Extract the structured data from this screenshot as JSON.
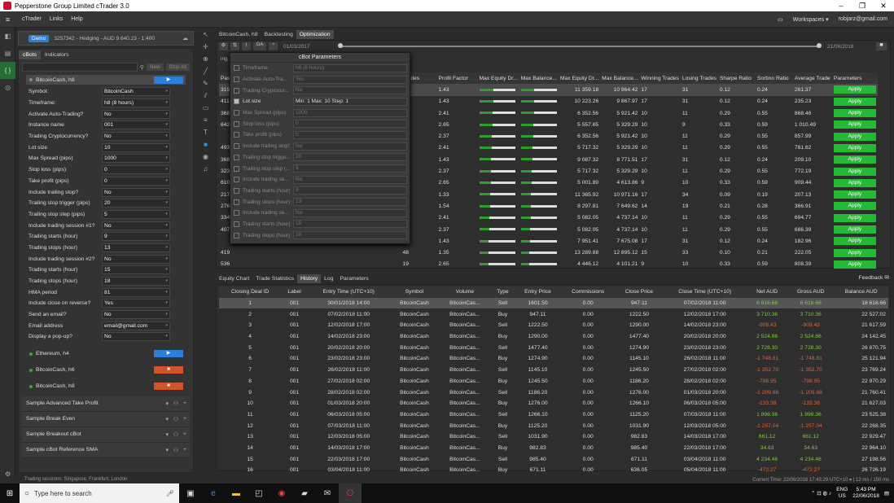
{
  "window": {
    "title": "Pepperstone Group Limited cTrader 3.0"
  },
  "menu": [
    "cTrader",
    "Links",
    "Help"
  ],
  "menu_right": {
    "workspaces": "Workspaces ▾",
    "user": "robjarz@gmail.com"
  },
  "account": {
    "badge": "Demo",
    "text": "3257342 - Hedging - AUD 9 640.23 - 1:400"
  },
  "left_tabs": [
    "cBots",
    "Indicators"
  ],
  "cbot_buttons": {
    "new": "New",
    "stop_all": "Stop All"
  },
  "instance_header": "BitcoinCash, h8",
  "params": [
    {
      "label": "Symbol:",
      "value": "BitcoinCash"
    },
    {
      "label": "Timeframe:",
      "value": "h8 (8 hours)"
    },
    {
      "label": "Activate Auto-Trading?",
      "value": "No"
    },
    {
      "label": "Instance name",
      "value": "001"
    },
    {
      "label": "Trading Cryptocurrency?",
      "value": "No"
    },
    {
      "label": "Lot size",
      "value": "10"
    },
    {
      "label": "Max Spread (pips)",
      "value": "1000"
    },
    {
      "label": "Stop loss (pips)",
      "value": "0"
    },
    {
      "label": "Take profit (pips)",
      "value": "0"
    },
    {
      "label": "Include trailing stop?",
      "value": "No"
    },
    {
      "label": "Trailing stop trigger (pips)",
      "value": "20"
    },
    {
      "label": "Trailing stop step (pips)",
      "value": "5"
    },
    {
      "label": "Include trading session #1?",
      "value": "No"
    },
    {
      "label": "Trading starts (hour)",
      "value": "9"
    },
    {
      "label": "Trading stops (hour)",
      "value": "13"
    },
    {
      "label": "Include trading session #2?",
      "value": "No"
    },
    {
      "label": "Trading starts (hour)",
      "value": "15"
    },
    {
      "label": "Trading stops (hour)",
      "value": "18"
    },
    {
      "label": "HMA period",
      "value": "81"
    },
    {
      "label": "Include close on reverse?",
      "value": "Yes"
    },
    {
      "label": "Send an email?",
      "value": "No"
    },
    {
      "label": "Email address",
      "value": "email@gmail.com"
    },
    {
      "label": "Display a pop-up?",
      "value": "No"
    }
  ],
  "instances": [
    {
      "name": "Ethereum, h4",
      "state": "play"
    },
    {
      "name": "BitcoinCash, h6",
      "state": "stop"
    },
    {
      "name": "BitcoinCash, h8",
      "state": "stop"
    }
  ],
  "samples": [
    "Sample Advanced Take Profit",
    "Sample Break Even",
    "Sample Breakout cBot",
    "Sample cBot Reference SMA"
  ],
  "status_left": "Trading sessions:  Singapore, Frankfurt, London",
  "status_right": "Current Time: 22/06/2018 17:43:29   UTC+10 ▾   |  12 ms / 150 ms",
  "right_tabs": [
    "BitcoinCash, h8",
    "Backtesting",
    "Optimization"
  ],
  "opt": {
    "start_date": "01/03/2017",
    "end_date": "21/06/2018",
    "remaining": "ing time: 0s"
  },
  "dialog": {
    "title": "cBot Parameters",
    "rows": [
      {
        "label": "Timeframe",
        "value": "h8 (8 hours)",
        "checked": false
      },
      {
        "label": "Activate Auto-Tra...",
        "value": "Yes",
        "checked": false
      },
      {
        "label": "Trading Cryptocur...",
        "value": "No",
        "checked": false
      },
      {
        "label": "Lot size",
        "value": "Min: 1    Max: 10    Step: 1",
        "checked": true
      },
      {
        "label": "Max Spread (pips)",
        "value": "1000",
        "checked": false
      },
      {
        "label": "Stop loss (pips)",
        "value": "0",
        "checked": false
      },
      {
        "label": "Take profit (pips)",
        "value": "0",
        "checked": false
      },
      {
        "label": "Include trailing stop?",
        "value": "No",
        "checked": false
      },
      {
        "label": "Trailing stop trigge...",
        "value": "20",
        "checked": false
      },
      {
        "label": "Trailing stop step (...",
        "value": "5",
        "checked": false
      },
      {
        "label": "Include trading se...",
        "value": "No",
        "checked": false
      },
      {
        "label": "Trading starts (hour)",
        "value": "9",
        "checked": false
      },
      {
        "label": "Trading stops (hour)",
        "value": "13",
        "checked": false
      },
      {
        "label": "Include trading se...",
        "value": "No",
        "checked": false
      },
      {
        "label": "Trading starts (hour)",
        "value": "15",
        "checked": false
      },
      {
        "label": "Trading stops (hour)",
        "value": "18",
        "checked": false
      }
    ]
  },
  "opt_headers": [
    "Pas",
    "Trades",
    "Profit Factor",
    "Max Equity Dr...",
    "Max Balance...",
    "Max Equity Dr...",
    "Max Balance...",
    "Winning Trades",
    "Losing Trades",
    "Sharpe Ratio",
    "Sortino Ratio",
    "Average Trade",
    "Parameters"
  ],
  "opt_rows": [
    [
      "319",
      "48",
      "1.43",
      "11 359.18",
      "10 964.42",
      "17",
      "31",
      "0.12",
      "0.24",
      "261.37"
    ],
    [
      "411",
      "48",
      "1.43",
      "10 223.26",
      "9 867.97",
      "17",
      "31",
      "0.12",
      "0.24",
      "235.23"
    ],
    [
      "368",
      "21",
      "2.41",
      "6 352.56",
      "5 921.42",
      "10",
      "11",
      "0.29",
      "0.55",
      "868.46"
    ],
    [
      "642",
      "19",
      "2.65",
      "5 557.65",
      "5 329.29",
      "10",
      "9",
      "0.33",
      "0.59",
      "1 010.49"
    ],
    [
      "",
      "21",
      "2.37",
      "6 352.56",
      "5 921.42",
      "10",
      "11",
      "0.29",
      "0.55",
      "857.99"
    ],
    [
      "493",
      "21",
      "2.41",
      "5 717.32",
      "5 329.29",
      "10",
      "11",
      "0.29",
      "0.55",
      "781.62"
    ],
    [
      "368",
      "48",
      "1.43",
      "9 087.32",
      "8 771.51",
      "17",
      "31",
      "0.12",
      "0.24",
      "209.10"
    ],
    [
      "323",
      "21",
      "2.37",
      "5 717.32",
      "5 329.29",
      "10",
      "11",
      "0.29",
      "0.55",
      "772.19"
    ],
    [
      "610",
      "19",
      "2.65",
      "5 001.89",
      "4 613.86",
      "9",
      "10",
      "0.33",
      "0.59",
      "909.44"
    ],
    [
      "217",
      "51",
      "1.33",
      "11 365.92",
      "10 971.16",
      "17",
      "34",
      "0.09",
      "0.19",
      "207.13"
    ],
    [
      "276",
      "33",
      "1.54",
      "8 297.81",
      "7 649.62",
      "14",
      "19",
      "0.21",
      "0.28",
      "366.91"
    ],
    [
      "334",
      "21",
      "2.41",
      "5 082.05",
      "4 737.14",
      "10",
      "11",
      "0.29",
      "0.55",
      "694.77"
    ],
    [
      "407",
      "21",
      "2.37",
      "5 082.05",
      "4 737.14",
      "10",
      "11",
      "0.29",
      "0.55",
      "686.39"
    ],
    [
      "",
      "48",
      "1.43",
      "7 951.41",
      "7 675.08",
      "17",
      "31",
      "0.12",
      "0.24",
      "182.96"
    ],
    [
      "419",
      "48",
      "1.35",
      "13 289.88",
      "12 895.12",
      "15",
      "33",
      "0.10",
      "0.21",
      "222.05"
    ],
    [
      "536",
      "19",
      "2.65",
      "4 446.12",
      "4 101.21",
      "9",
      "10",
      "0.33",
      "0.59",
      "808.39"
    ]
  ],
  "opt_extra": {
    "r14": [
      "113 912.06",
      "20 523.01",
      "20 745.32",
      "10 745.32"
    ],
    "r15": [
      "113 696.67",
      "25 046.87",
      "25 359.45",
      "15 359.45"
    ]
  },
  "apply_label": "Apply",
  "bottom_tabs": [
    "Equity Chart",
    "Trade Statistics",
    "History",
    "Log",
    "Parameters"
  ],
  "feedback": "Feedback",
  "hist_headers": [
    "Closing Deal ID",
    "Label",
    "Entry Time (UTC+10)",
    "Symbol",
    "Volume",
    "Type",
    "Entry Price",
    "Commissions",
    "Close Price",
    "Close Time (UTC+10)",
    "Net AUD",
    "Gross AUD",
    "Balance AUD"
  ],
  "hist_rows": [
    [
      "1",
      "001",
      "30/01/2018 14:00",
      "BitcoinCash",
      "BitcoinCas...",
      "Sell",
      "1601.50",
      "0.00",
      "947.11",
      "07/02/2018 11:00",
      "6 616.66",
      "6 616.66",
      "18 616.66"
    ],
    [
      "2",
      "001",
      "07/02/2018 11:00",
      "BitcoinCash",
      "BitcoinCas...",
      "Buy",
      "947.11",
      "0.00",
      "1222.50",
      "12/02/2018 17:00",
      "3 710.36",
      "3 710.36",
      "22 527.02"
    ],
    [
      "3",
      "001",
      "12/02/2018 17:00",
      "BitcoinCash",
      "BitcoinCas...",
      "Sell",
      "1222.50",
      "0.00",
      "1290.00",
      "14/02/2018 23:00",
      "-909.43",
      "-909.43",
      "21 617.59"
    ],
    [
      "4",
      "001",
      "14/02/2018 23:00",
      "BitcoinCash",
      "BitcoinCas...",
      "Buy",
      "1290.00",
      "0.00",
      "1477.40",
      "20/02/2018 20:00",
      "2 524.86",
      "2 524.86",
      "24 142.45"
    ],
    [
      "5",
      "001",
      "20/02/2018 20:00",
      "BitcoinCash",
      "BitcoinCas...",
      "Sell",
      "1477.40",
      "0.00",
      "1274.90",
      "23/02/2018 23:00",
      "2 728.30",
      "2 728.30",
      "26 870.75"
    ],
    [
      "6",
      "001",
      "23/02/2018 23:00",
      "BitcoinCash",
      "BitcoinCas...",
      "Buy",
      "1274.90",
      "0.00",
      "1145.10",
      "26/02/2018 11:00",
      "-1 748.81",
      "-1 748.81",
      "25 121.94"
    ],
    [
      "7",
      "001",
      "26/02/2018 11:00",
      "BitcoinCash",
      "BitcoinCas...",
      "Sell",
      "1145.10",
      "0.00",
      "1245.50",
      "27/02/2018 02:00",
      "-1 352.70",
      "-1 352.70",
      "23 769.24"
    ],
    [
      "8",
      "001",
      "27/02/2018 02:00",
      "BitcoinCash",
      "BitcoinCas...",
      "Buy",
      "1245.50",
      "0.00",
      "1186.20",
      "28/02/2018 02:00",
      "-798.95",
      "-798.95",
      "22 970.29"
    ],
    [
      "9",
      "001",
      "28/02/2018 02:00",
      "BitcoinCash",
      "BitcoinCas...",
      "Sell",
      "1186.20",
      "0.00",
      "1276.00",
      "01/03/2018 20:00",
      "-1 209.88",
      "-1 209.88",
      "21 760.41"
    ],
    [
      "10",
      "001",
      "01/03/2018 20:00",
      "BitcoinCash",
      "BitcoinCas...",
      "Buy",
      "1276.00",
      "0.00",
      "1266.10",
      "06/03/2018 05:00",
      "-133.38",
      "-133.38",
      "21 627.03"
    ],
    [
      "11",
      "001",
      "06/03/2018 05:00",
      "BitcoinCash",
      "BitcoinCas...",
      "Sell",
      "1266.10",
      "0.00",
      "1125.20",
      "07/03/2018 11:00",
      "1 898.36",
      "1 898.36",
      "23 525.38"
    ],
    [
      "12",
      "001",
      "07/03/2018 11:00",
      "BitcoinCash",
      "BitcoinCas...",
      "Buy",
      "1125.20",
      "0.00",
      "1031.90",
      "12/03/2018 05:00",
      "-1 257.04",
      "-1 257.04",
      "22 268.35"
    ],
    [
      "13",
      "001",
      "12/03/2018 05:00",
      "BitcoinCash",
      "BitcoinCas...",
      "Sell",
      "1031.90",
      "0.00",
      "982.83",
      "14/03/2018 17:00",
      "661.12",
      "661.12",
      "22 929.47"
    ],
    [
      "14",
      "001",
      "14/03/2018 17:00",
      "BitcoinCash",
      "BitcoinCas...",
      "Buy",
      "982.83",
      "0.00",
      "985.40",
      "22/03/2018 17:00",
      "34.63",
      "34.63",
      "22 964.10"
    ],
    [
      "15",
      "001",
      "22/03/2018 17:00",
      "BitcoinCash",
      "BitcoinCas...",
      "Sell",
      "985.40",
      "0.00",
      "671.11",
      "03/04/2018 11:00",
      "4 234.46",
      "4 234.46",
      "27 198.56"
    ],
    [
      "16",
      "001",
      "03/04/2018 11:00",
      "BitcoinCash",
      "BitcoinCas...",
      "Buy",
      "671.11",
      "0.00",
      "636.05",
      "05/04/2018 11:00",
      "-472.27",
      "-472.27",
      "26 726.19"
    ]
  ],
  "taskbar": {
    "search_placeholder": "Type here to search",
    "lang": "ENG",
    "region": "US",
    "time": "5:43 PM",
    "date": "22/06/2018"
  }
}
